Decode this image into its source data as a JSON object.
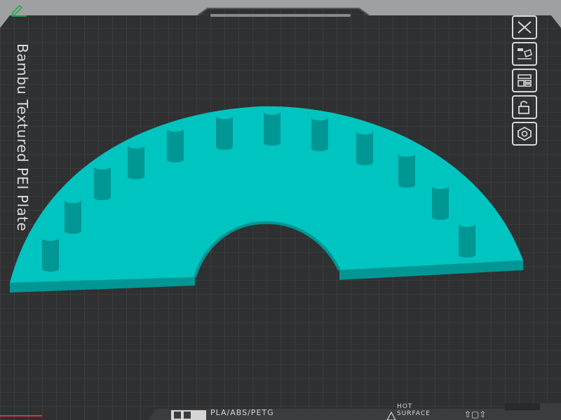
{
  "plate": {
    "label": "Bambu Textured PEI Plate"
  },
  "bottom_bar": {
    "filament_types": "PLA/ABS/PETG",
    "hot_surface_line1": "HOT",
    "hot_surface_line2": "SURFACE"
  },
  "toolbar": {
    "icons": [
      "close-icon",
      "auto-orient-icon",
      "arrange-icon",
      "lock-icon",
      "settings-hex-icon"
    ]
  },
  "colors": {
    "background": "#9ea0a2",
    "plate": "#2f3031",
    "grid": "#505254",
    "model_top": "#00c4c0",
    "model_side": "#009694",
    "accent_green": "#20b050"
  }
}
